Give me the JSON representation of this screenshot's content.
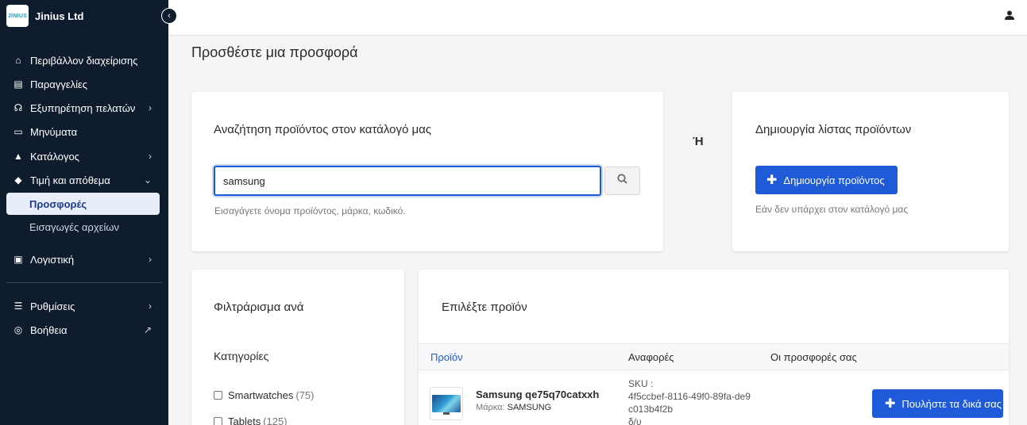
{
  "brand": {
    "logo_text": "JINIUS",
    "name": "Jinius Ltd"
  },
  "sidebar": {
    "items": [
      {
        "label": "Περιβάλλον διαχείρισης",
        "icon": "home-icon"
      },
      {
        "label": "Παραγγελίες",
        "icon": "clipboard-icon"
      },
      {
        "label": "Εξυπηρέτηση πελατών",
        "icon": "headset-icon"
      },
      {
        "label": "Μηνύματα",
        "icon": "chat-icon"
      },
      {
        "label": "Κατάλογος",
        "icon": "shapes-icon"
      },
      {
        "label": "Τιμή και απόθεμα",
        "icon": "tag-icon"
      },
      {
        "label": "Προσφορές",
        "icon": ""
      },
      {
        "label": "Εισαγωγές αρχείων",
        "icon": ""
      },
      {
        "label": "Λογιστική",
        "icon": "invoice-icon"
      },
      {
        "label": "Ρυθμίσεις",
        "icon": "sliders-icon"
      },
      {
        "label": "Βοήθεια",
        "icon": "lifebuoy-icon"
      }
    ]
  },
  "page": {
    "title": "Προσθέστε μια προσφορά"
  },
  "search_card": {
    "title": "Αναζήτηση προϊόντος στον κατάλογό μας",
    "value": "samsung",
    "hint": "Εισαγάγετε όνομα προϊόντος, μάρκα, κωδικό."
  },
  "or_label": "Ή",
  "create_card": {
    "title": "Δημιουργία λίστας προϊόντων",
    "button": "Δημιουργία προϊόντος",
    "hint": "Εάν δεν υπάρχει στον κατάλογό μας"
  },
  "filter_card": {
    "title": "Φιλτράρισμα ανά",
    "section": "Κατηγορίες",
    "categories": [
      {
        "name": "Smartwatches",
        "count": "(75)"
      },
      {
        "name": "Tablets",
        "count": "(125)"
      }
    ]
  },
  "products_card": {
    "title": "Επιλέξτε προϊόν",
    "columns": [
      "Προϊόν",
      "Αναφορές",
      "Οι προσφορές σας"
    ],
    "rows": [
      {
        "name": "Samsung qe75q70catxxh",
        "brand_label": "Μάρκα:",
        "brand": "SAMSUNG",
        "sku_label": "SKU :",
        "sku": "4f5ccbef-8116-49f0-89fa-de9c013b4f2b",
        "sku_extra": "δ/υ",
        "action": "Πουλήστε τα δικά σας"
      }
    ]
  }
}
